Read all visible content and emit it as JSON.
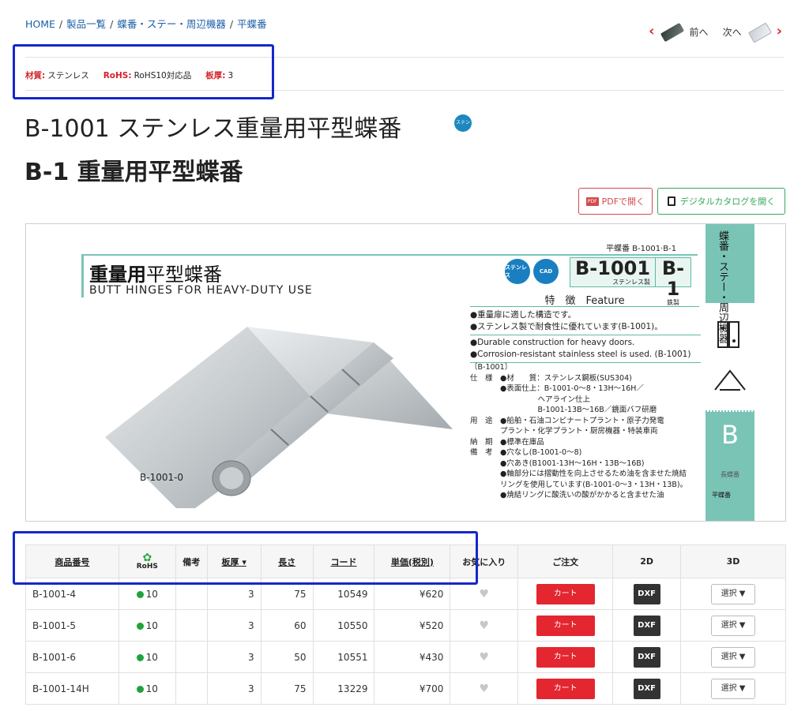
{
  "breadcrumb": [
    "HOME",
    "製品一覧",
    "蝶番・ステー・周辺機器",
    "平蝶番"
  ],
  "nav": {
    "prev": "前へ",
    "next": "次へ"
  },
  "specs": [
    {
      "key": "材質:",
      "value": "ステンレス"
    },
    {
      "key": "RoHS:",
      "value": "RoHS10対応品"
    },
    {
      "key": "板厚:",
      "value": "3"
    }
  ],
  "title_line1": "B-1001 ステンレス重量用平型蝶番",
  "title_line2": "B-1 重量用平型蝶番",
  "sus_badge": "ステンレス",
  "buttons": {
    "pdf": "PDFで開く",
    "pdf_icon": "PDF",
    "catalog": "デジタルカタログを開く"
  },
  "catalog": {
    "ref": "平蝶番  B-1001·B-1",
    "title_bold": "重量用",
    "title_rest": "平型蝶番",
    "title_en": "BUTT HINGES FOR HEAVY-DUTY USE",
    "badge_sus": "ステンレス",
    "badge_cad": "CAD",
    "model1": "B-1001",
    "model1_sub": "ステンレス製",
    "model2": "B-1",
    "model2_sub": "鉄製",
    "feature": "特　徴　Feature",
    "bullets_jp": [
      "●重量扉に適した構造です。",
      "●ステンレス製で耐食性に優れています(B-1001)。"
    ],
    "bullets_en": [
      "●Durable construction for heavy doors.",
      "●Corrosion-resistant stainless steel is used. (B-1001)"
    ],
    "spec_lines": [
      "〔B-1001〕",
      "仕　様　●材　　質：ステンレス鋼板(SUS304)",
      "　　　　●表面仕上：B-1001-0～8・13H～16H／",
      "　　　　　　　　　ヘアライン仕上",
      "　　　　　　　　　B-1001-13B～16B／鏡面バフ研磨",
      "用　途　●船舶・石油コンビナートプラント・原子力発電",
      "　　　　プラント・化学プラント・厨房機器・特装車両",
      "納　期　●標準在庫品",
      "備　考　●穴なし(B-1001-0～8)",
      "　　　　●穴あき(B1001-13H～16H・13B～16B)",
      "　　　　●軸部分には摺動性を向上させるため油を含ませた焼結",
      "　　　　リングを使用しています(B-1001-0～3・13H・13B)。",
      "　　　　●焼結リングに酸洗いの酸がかかると含ませた油"
    ],
    "side_band": "蝶番・ステー・周辺機器",
    "side_big": "B",
    "side_long": "長蝶番",
    "side_flat": "平蝶番",
    "image_label": "B-1001-0"
  },
  "table": {
    "headers": [
      "商品番号",
      "RoHS",
      "備考",
      "板厚 ▾",
      "長さ",
      "コード",
      "単価(税別)",
      "お気に入り",
      "ご注文",
      "2D",
      "3D"
    ],
    "rows": [
      {
        "item": "B-1001-4",
        "rohs": "10",
        "note": "",
        "thickness": "3",
        "length": "75",
        "code": "10549",
        "price": "¥620"
      },
      {
        "item": "B-1001-5",
        "rohs": "10",
        "note": "",
        "thickness": "3",
        "length": "60",
        "code": "10550",
        "price": "¥520"
      },
      {
        "item": "B-1001-6",
        "rohs": "10",
        "note": "",
        "thickness": "3",
        "length": "50",
        "code": "10551",
        "price": "¥430"
      },
      {
        "item": "B-1001-14H",
        "rohs": "10",
        "note": "",
        "thickness": "3",
        "length": "75",
        "code": "13229",
        "price": "¥700"
      }
    ],
    "cart_label": "カート",
    "dxf_label": "DXF",
    "select_label": "選択 ▼",
    "heart": "♥"
  },
  "colors": {
    "accent_red": "#e3262f",
    "link_blue": "#1a5ea8",
    "highlight": "#1428c8",
    "teal": "#7ac4b6"
  }
}
